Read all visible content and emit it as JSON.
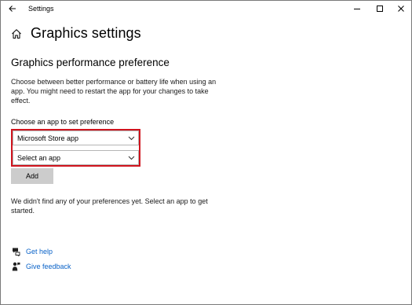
{
  "window": {
    "title": "Settings",
    "back_icon": "arrow-left-icon",
    "minimize_icon": "minimize-icon",
    "maximize_icon": "maximize-icon",
    "close_icon": "close-icon"
  },
  "header": {
    "home_icon": "home-icon",
    "title": "Graphics settings"
  },
  "section": {
    "title": "Graphics performance preference",
    "description": "Choose between better performance or battery life when using an app. You might need to restart the app for your changes to take effect.",
    "choose_label": "Choose an app to set preference"
  },
  "dropdowns": {
    "app_type": {
      "value": "Microsoft Store app"
    },
    "app": {
      "value": "Select an app"
    }
  },
  "actions": {
    "add_label": "Add"
  },
  "empty_message": "We didn't find any of your preferences yet. Select an app to get started.",
  "links": {
    "help": {
      "label": "Get help",
      "icon": "help-chat-icon"
    },
    "feedback": {
      "label": "Give feedback",
      "icon": "feedback-person-icon"
    }
  },
  "colors": {
    "highlight_border": "#d0141e",
    "link": "#0b63c8",
    "button_bg": "#cccccc"
  }
}
